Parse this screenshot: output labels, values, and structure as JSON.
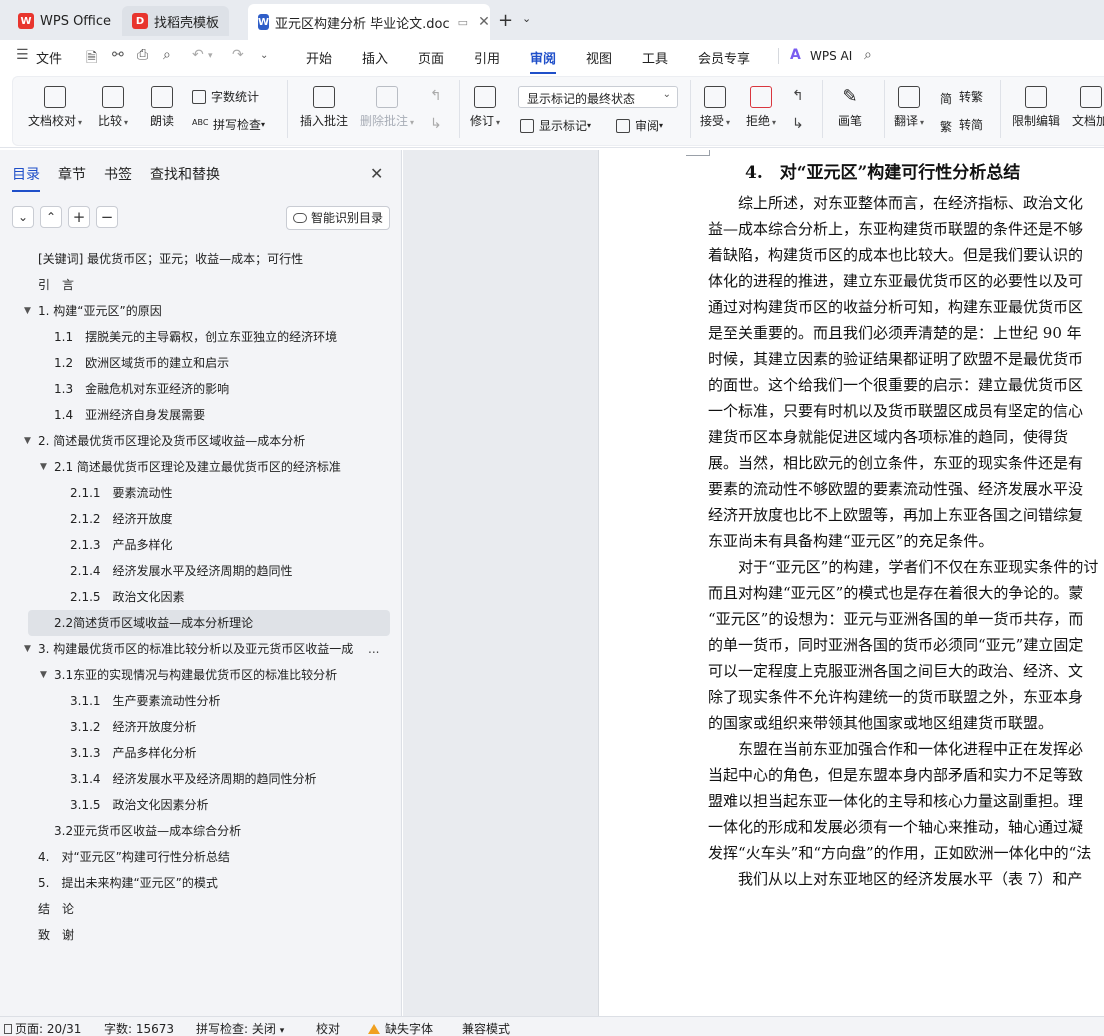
{
  "tabs": [
    {
      "label": "WPS Office",
      "icon": "wps-logo-icon",
      "color": "#e8352e"
    },
    {
      "label": "找稻壳模板",
      "icon": "docer-logo-icon",
      "color": "#e8352e"
    },
    {
      "label": "亚元区构建分析 毕业论文.doc",
      "icon": "word-doc-icon",
      "color": "#2f5ec8"
    }
  ],
  "menu": {
    "file": "文件",
    "items": [
      "开始",
      "插入",
      "页面",
      "引用",
      "审阅",
      "视图",
      "工具",
      "会员专享"
    ],
    "active": "审阅",
    "ai": "WPS AI"
  },
  "ribbon": {
    "doc_check": "文档校对",
    "compare": "比较",
    "read_aloud": "朗读",
    "word_count": "字数统计",
    "spell_check": "拼写检查",
    "insert_comment": "插入批注",
    "delete_comment": "删除批注",
    "revise": "修订",
    "markup_state": "显示标记的最终状态",
    "show_markup": "显示标记",
    "review_pane": "审阅",
    "accept": "接受",
    "reject": "拒绝",
    "pen": "画笔",
    "translate": "翻译",
    "to_traditional": "转繁",
    "to_simplified": "转简",
    "restrict_edit": "限制编辑",
    "doc_protect": "文档加"
  },
  "nav": {
    "tabs": [
      "目录",
      "章节",
      "书签",
      "查找和替换"
    ],
    "active": "目录",
    "smart_toc": "智能识别目录",
    "toc": [
      {
        "text": "[关键词] 最优货币区；亚元；收益—成本；可行性",
        "level": 0,
        "toggle": ""
      },
      {
        "text": "引　言",
        "level": 0,
        "toggle": ""
      },
      {
        "text": "1. 构建“亚元区”的原因",
        "level": 0,
        "toggle": "▼"
      },
      {
        "text": "1.1　摆脱美元的主导霸权，创立东亚独立的经济环境",
        "level": 1,
        "toggle": ""
      },
      {
        "text": "1.2　欧洲区域货币的建立和启示",
        "level": 1,
        "toggle": ""
      },
      {
        "text": "1.3　金融危机对东亚经济的影响",
        "level": 1,
        "toggle": ""
      },
      {
        "text": "1.4　亚洲经济自身发展需要",
        "level": 1,
        "toggle": ""
      },
      {
        "text": "2. 简述最优货币区理论及货币区域收益—成本分析",
        "level": 0,
        "toggle": "▼"
      },
      {
        "text": "2.1 简述最优货币区理论及建立最优货币区的经济标准",
        "level": 1,
        "toggle": "▼"
      },
      {
        "text": "2.1.1　要素流动性",
        "level": 2,
        "toggle": ""
      },
      {
        "text": "2.1.2　经济开放度",
        "level": 2,
        "toggle": ""
      },
      {
        "text": "2.1.3　产品多样化",
        "level": 2,
        "toggle": ""
      },
      {
        "text": "2.1.4　经济发展水平及经济周期的趋同性",
        "level": 2,
        "toggle": ""
      },
      {
        "text": "2.1.5　政治文化因素",
        "level": 2,
        "toggle": ""
      },
      {
        "text": "2.2简述货币区域收益—成本分析理论",
        "level": 1,
        "toggle": "",
        "selected": true
      },
      {
        "text": "3. 构建最优货币区的标准比较分析以及亚元货币区收益一成",
        "level": 0,
        "toggle": "▼",
        "more": "..."
      },
      {
        "text": "3.1东亚的实现情况与构建最优货币区的标准比较分析",
        "level": 1,
        "toggle": "▼"
      },
      {
        "text": "3.1.1　生产要素流动性分析",
        "level": 2,
        "toggle": ""
      },
      {
        "text": "3.1.2　经济开放度分析",
        "level": 2,
        "toggle": ""
      },
      {
        "text": "3.1.3　产品多样化分析",
        "level": 2,
        "toggle": ""
      },
      {
        "text": "3.1.4　经济发展水平及经济周期的趋同性分析",
        "level": 2,
        "toggle": ""
      },
      {
        "text": "3.1.5　政治文化因素分析",
        "level": 2,
        "toggle": ""
      },
      {
        "text": "3.2亚元货币区收益—成本综合分析",
        "level": 1,
        "toggle": ""
      },
      {
        "text": "4.　对“亚元区”构建可行性分析总结",
        "level": 0,
        "toggle": ""
      },
      {
        "text": "5.　提出未来构建“亚元区”的模式",
        "level": 0,
        "toggle": ""
      },
      {
        "text": "结　论",
        "level": 0,
        "toggle": ""
      },
      {
        "text": "致　谢",
        "level": 0,
        "toggle": ""
      }
    ]
  },
  "document": {
    "heading": "4.　对“亚元区”构建可行性分析总结",
    "lines": [
      {
        "text": "　　综上所述，对东亚整体而言，在经济指标、政治文化",
        "indent": true
      },
      {
        "text": "益—成本综合分析上，东亚构建货币联盟的条件还是不够",
        "indent": false
      },
      {
        "text": "着缺陷，构建货币区的成本也比较大。但是我们要认识的",
        "indent": false
      },
      {
        "text": "体化的进程的推进，建立东亚最优货币区的必要性以及可",
        "indent": false
      },
      {
        "text": "通过对构建货币区的收益分析可知，构建东亚最优货币区",
        "indent": false
      },
      {
        "text": "是至关重要的。而且我们必须弄清楚的是：上世纪 90 年",
        "indent": false
      },
      {
        "text": "时候，其建立因素的验证结果都证明了欧盟不是最优货币",
        "indent": false
      },
      {
        "text": "的面世。这个给我们一个很重要的启示：建立最优货币区",
        "indent": false
      },
      {
        "text": "一个标准，只要有时机以及货币联盟区成员有坚定的信心",
        "indent": false
      },
      {
        "text": "建货币区本身就能促进区域内各项标准的趋同，使得货",
        "indent": false
      },
      {
        "text": "展。当然，相比欧元的创立条件，东亚的现实条件还是有",
        "indent": false
      },
      {
        "text": "要素的流动性不够欧盟的要素流动性强、经济发展水平没",
        "indent": false
      },
      {
        "text": "经济开放度也比不上欧盟等，再加上东亚各国之间错综复",
        "indent": false
      },
      {
        "text": "东亚尚未有具备构建“亚元区”的充足条件。",
        "indent": false
      },
      {
        "text": "　　对于“亚元区”的构建，学者们不仅在东亚现实条件的讨",
        "indent": true
      },
      {
        "text": "而且对构建“亚元区”的模式也是存在着很大的争论的。蒙",
        "indent": false
      },
      {
        "text": "“亚元区”的设想为：亚元与亚洲各国的单一货币共存，而",
        "indent": false
      },
      {
        "text": "的单一货币，同时亚洲各国的货币必须同“亚元”建立固定",
        "indent": false
      },
      {
        "text": "可以一定程度上克服亚洲各国之间巨大的政治、经济、文",
        "indent": false
      },
      {
        "text": "除了现实条件不允许构建统一的货币联盟之外，东亚本身",
        "indent": false
      },
      {
        "text": "的国家或组织来带领其他国家或地区组建货币联盟。",
        "indent": false
      },
      {
        "text": "　　东盟在当前东亚加强合作和一体化进程中正在发挥必",
        "indent": true
      },
      {
        "text": "当起中心的角色，但是东盟本身内部矛盾和实力不足等致",
        "indent": false
      },
      {
        "text": "盟难以担当起东亚一体化的主导和核心力量这副重担。理",
        "indent": false
      },
      {
        "text": "一体化的形成和发展必须有一个轴心来推动，轴心通过凝",
        "indent": false
      },
      {
        "text": "发挥“火车头”和“方向盘”的作用，正如欧洲一体化中的“法",
        "indent": false
      },
      {
        "text": "　　我们从以上对东亚地区的经济发展水平（表 7）和产",
        "indent": true
      }
    ]
  },
  "status": {
    "page": "页面: 20/31",
    "words": "字数: 15673",
    "spell": "拼写检查: 关闭",
    "proof": "校对",
    "missing_font": "缺失字体",
    "compat": "兼容模式"
  }
}
